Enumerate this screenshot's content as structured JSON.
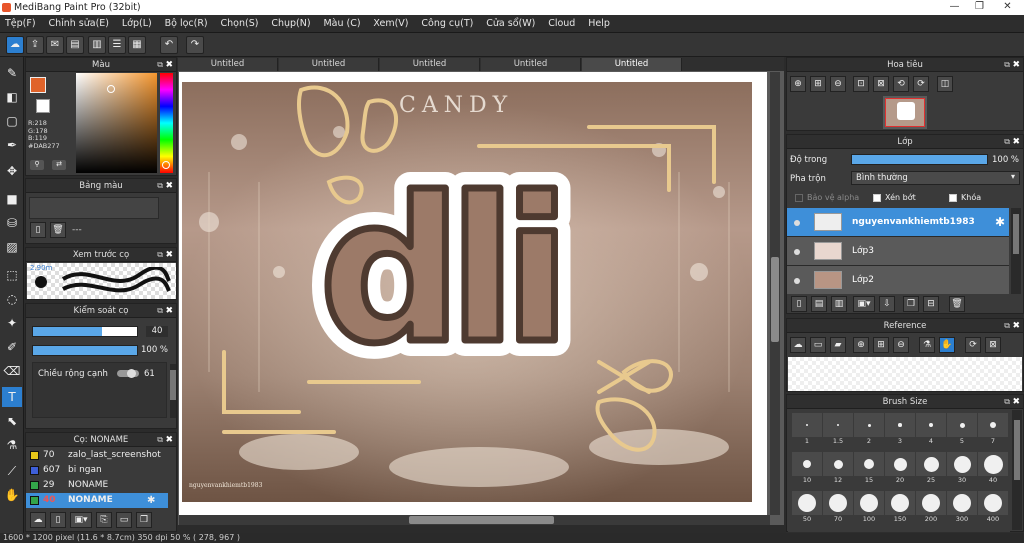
{
  "app": {
    "title": "MediBang Paint Pro (32bit)"
  },
  "menu": [
    "Tệp(F)",
    "Chỉnh sửa(E)",
    "Lớp(L)",
    "Bộ lọc(R)",
    "Chọn(S)",
    "Chụp(N)",
    "Màu (C)",
    "Xem(V)",
    "Công cụ(T)",
    "Cửa sổ(W)",
    "Cloud",
    "Help"
  ],
  "tabs": [
    "Untitled",
    "Untitled",
    "Untitled",
    "Untitled",
    "Untitled"
  ],
  "color_panel": {
    "title": "Màu",
    "r": "R:218",
    "g": "G:178",
    "b": "B:119",
    "hex": "#DAB277",
    "accent": "#DAB277"
  },
  "palette_panel": {
    "title": "Bảng màu",
    "dash": "---"
  },
  "brush_preview": {
    "title": "Xem trước cọ",
    "size": "2.90m"
  },
  "brush_control": {
    "title": "Kiểm soát cọ",
    "size_value": "40",
    "opacity_value": "100 %",
    "edge_label": "Chiều rộng cạnh",
    "edge_value": "61"
  },
  "brush_list": {
    "title": "Cọ: NONAME",
    "items": [
      {
        "size": "70",
        "name": "zalo_last_screenshot",
        "color": "#e6c619"
      },
      {
        "size": "607",
        "name": "bi ngan",
        "color": "#3e5fd8"
      },
      {
        "size": "29",
        "name": "NONAME",
        "color": "#33a54a"
      },
      {
        "size": "40",
        "name": "NONAME",
        "color": "#33a54a"
      }
    ]
  },
  "navigator": {
    "title": "Hoa tiêu"
  },
  "layer_panel": {
    "title": "Lớp",
    "opacity_label": "Độ trong",
    "opacity_value": "100 %",
    "blend_label": "Pha trộn",
    "blend_value": "Bình thường",
    "protect_alpha": "Bảo vệ alpha",
    "clipping": "Xén bớt",
    "lock": "Khóa",
    "layers": [
      "nguyenvankhiemtb1983",
      "Lớp3",
      "Lớp2"
    ]
  },
  "reference": {
    "title": "Reference"
  },
  "brush_size": {
    "title": "Brush Size",
    "values": [
      "1",
      "1.5",
      "2",
      "3",
      "4",
      "5",
      "7",
      "10",
      "12",
      "15",
      "20",
      "25",
      "30",
      "40",
      "50",
      "70",
      "100",
      "150",
      "200",
      "300",
      "400"
    ]
  },
  "canvas": {
    "brand": "CANDY",
    "art_text": "dli",
    "credit": "nguyenvankhiemtb1983"
  },
  "status": {
    "text": "1600 * 1200 pixel   (11.6 * 8.7cm)   350 dpi   50 %   ( 278, 967 )"
  }
}
